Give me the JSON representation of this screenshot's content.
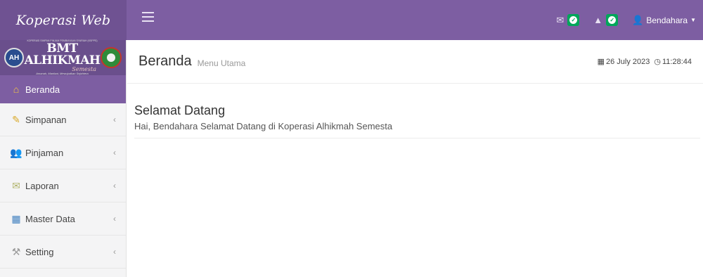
{
  "app": {
    "brand": "Koperasi Web"
  },
  "logo": {
    "org_line": "KOPERASI SIMPAN PINJAM PEMBIAYAAN SYARIAH (KSPPS)",
    "name": "BMT ALHIKMAH",
    "sub": "Semesta",
    "tagline": "Amanah, Manfaat, Mewujudkan Sejahtera"
  },
  "topnav": {
    "user_name": "Bendahara",
    "colors": {
      "bar": "#7d5ea2",
      "brand": "#6f5292",
      "badge": "#00a65a"
    },
    "icons": {
      "mail": "envelope-icon",
      "warning": "warning-icon",
      "user": "user-icon",
      "menu": "hamburger-icon"
    }
  },
  "sidebar": {
    "items": [
      {
        "label": "Beranda",
        "icon": "home-icon",
        "active": true
      },
      {
        "label": "Simpanan",
        "icon": "savings-icon",
        "chevron": "‹"
      },
      {
        "label": "Pinjaman",
        "icon": "people-icon",
        "chevron": "‹"
      },
      {
        "label": "Laporan",
        "icon": "report-icon",
        "chevron": "‹"
      },
      {
        "label": "Master Data",
        "icon": "database-icon",
        "chevron": "‹"
      },
      {
        "label": "Setting",
        "icon": "wrench-icon",
        "chevron": "‹"
      }
    ]
  },
  "header": {
    "title": "Beranda",
    "subtitle": "Menu Utama",
    "date": "26 July 2023",
    "time": "11:28:44"
  },
  "main": {
    "heading": "Selamat Datang",
    "message": "Hai, Bendahara Selamat Datang di Koperasi Alhikmah Semesta"
  }
}
